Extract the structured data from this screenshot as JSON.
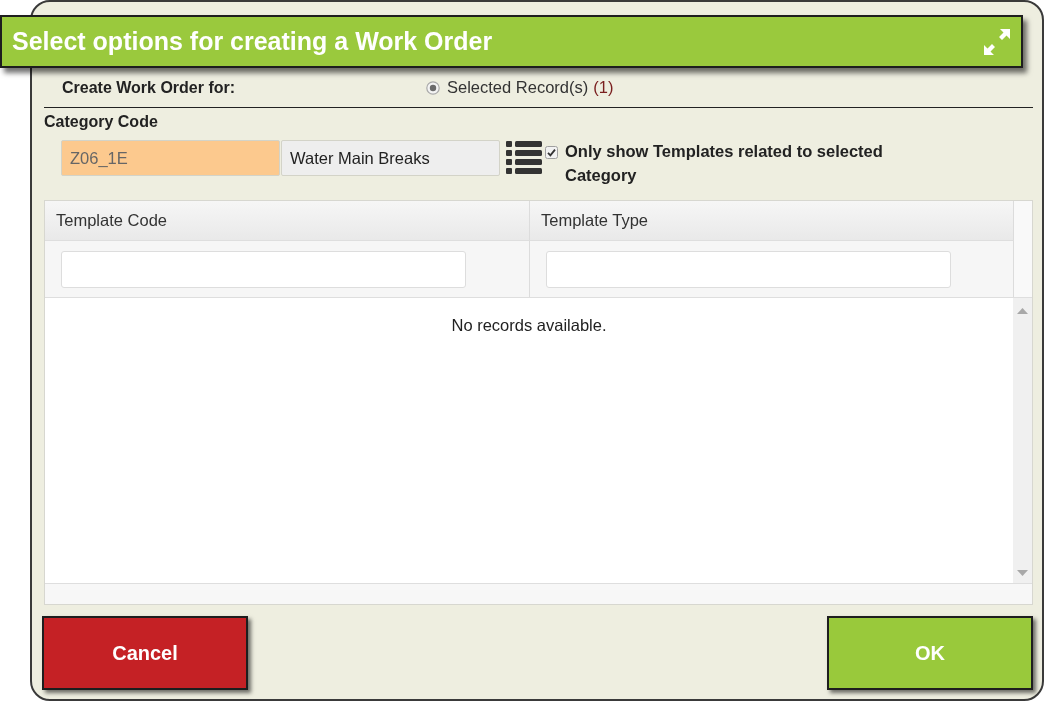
{
  "dialog": {
    "title": "Select options for creating a Work Order"
  },
  "create_for": {
    "label": "Create Work Order for:",
    "options": [
      {
        "label": "Selected Record(s)",
        "count": "(1)",
        "selected": true
      }
    ]
  },
  "category": {
    "label": "Category Code",
    "code": "Z06_1E",
    "description": "Water Main Breaks",
    "filter_checkbox": {
      "label": "Only show Templates related to selected Category",
      "checked": true
    }
  },
  "grid": {
    "columns": [
      {
        "title": "Template Code"
      },
      {
        "title": "Template Type"
      }
    ],
    "empty_message": "No records available."
  },
  "buttons": [
    {
      "label": "Cancel",
      "kind": "cancel"
    },
    {
      "label": "OK",
      "kind": "confirm"
    }
  ]
}
